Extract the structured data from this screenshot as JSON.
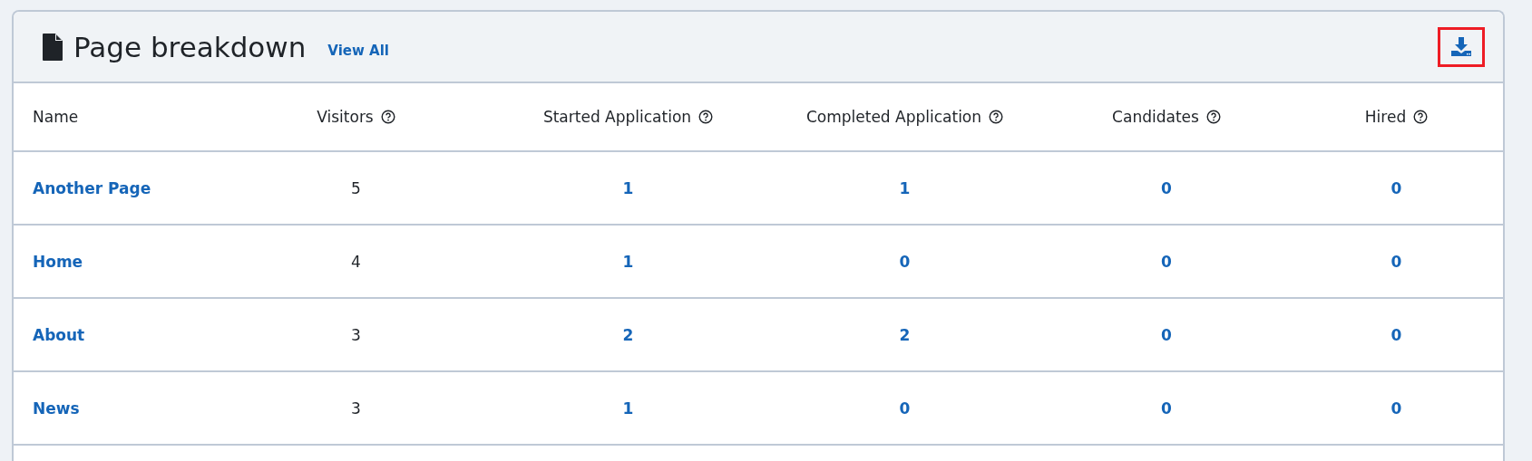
{
  "card": {
    "title": "Page breakdown",
    "view_all": "View All",
    "download_button": {
      "highlighted": true
    }
  },
  "table": {
    "columns": [
      {
        "label": "Name",
        "kind": "link",
        "help": false
      },
      {
        "label": "Visitors",
        "kind": "text",
        "help": true
      },
      {
        "label": "Started Application",
        "kind": "link",
        "help": true
      },
      {
        "label": "Completed Application",
        "kind": "link",
        "help": true
      },
      {
        "label": "Candidates",
        "kind": "link",
        "help": true
      },
      {
        "label": "Hired",
        "kind": "link",
        "help": true
      }
    ],
    "rows": [
      [
        "Another Page",
        "5",
        "1",
        "1",
        "0",
        "0"
      ],
      [
        "Home",
        "4",
        "1",
        "0",
        "0",
        "0"
      ],
      [
        "About",
        "3",
        "2",
        "2",
        "0",
        "0"
      ],
      [
        "News",
        "3",
        "1",
        "0",
        "0",
        "0"
      ]
    ]
  }
}
